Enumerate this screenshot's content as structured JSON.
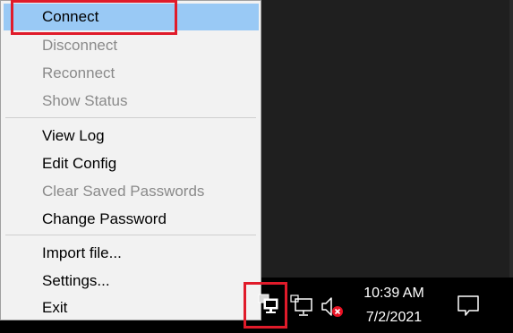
{
  "context_menu": {
    "items": [
      {
        "label": "Connect",
        "enabled": true,
        "highlighted": true
      },
      {
        "label": "Disconnect",
        "enabled": false
      },
      {
        "label": "Reconnect",
        "enabled": false
      },
      {
        "label": "Show Status",
        "enabled": false
      },
      {
        "label": "View Log",
        "enabled": true
      },
      {
        "label": "Edit Config",
        "enabled": true
      },
      {
        "label": "Clear Saved Passwords",
        "enabled": false
      },
      {
        "label": "Change Password",
        "enabled": true
      },
      {
        "label": "Import file...",
        "enabled": true
      },
      {
        "label": "Settings...",
        "enabled": true
      },
      {
        "label": "Exit",
        "enabled": true
      }
    ]
  },
  "taskbar": {
    "tray_icons": [
      "vpn-tray-icon",
      "network-icon",
      "volume-muted-icon"
    ],
    "clock": {
      "time": "10:39 AM",
      "date": "7/2/2021"
    },
    "notification_icon": "action-center-icon"
  },
  "colors": {
    "annotation": "#e01b2a",
    "menu_background": "#f2f2f2",
    "highlight": "#99c9f5",
    "taskbar": "#000000",
    "mute_badge": "#e81123"
  }
}
